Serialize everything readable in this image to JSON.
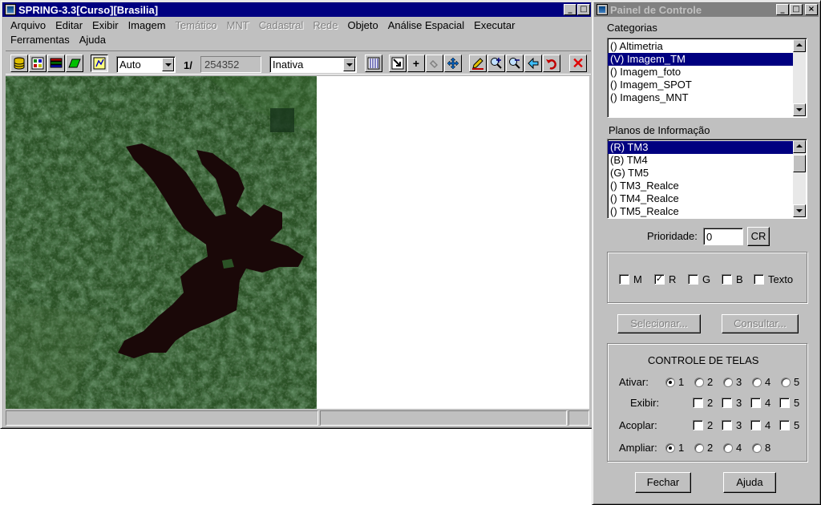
{
  "main_window": {
    "title": "SPRING-3.3[Curso][Brasilia]",
    "menu_row1": [
      {
        "label": "Arquivo",
        "enabled": true
      },
      {
        "label": "Editar",
        "enabled": true
      },
      {
        "label": "Exibir",
        "enabled": true
      },
      {
        "label": "Imagem",
        "enabled": true
      },
      {
        "label": "Temático",
        "enabled": false
      },
      {
        "label": "MNT",
        "enabled": false
      },
      {
        "label": "Cadastral",
        "enabled": false
      },
      {
        "label": "Rede",
        "enabled": false
      },
      {
        "label": "Objeto",
        "enabled": true
      },
      {
        "label": "Análise Espacial",
        "enabled": true
      },
      {
        "label": "Executar",
        "enabled": true
      }
    ],
    "menu_row2": [
      {
        "label": "Ferramentas",
        "enabled": true
      },
      {
        "label": "Ajuda",
        "enabled": true
      }
    ],
    "toolbar": {
      "zoom_mode": "Auto",
      "scale_prefix": "1/",
      "scale_value": "254352",
      "state": "Inativa"
    },
    "image": {
      "description_icons": [
        "database-icon",
        "layers-icon",
        "theme-icon",
        "polygon-icon",
        "cursor-icon"
      ],
      "water_color": "#1a0808",
      "vegetation_color": "#2f5a2a"
    }
  },
  "control_panel": {
    "title": "Painel de Controle",
    "categories_label": "Categorias",
    "categories": [
      {
        "label": "() Altimetria",
        "selected": false
      },
      {
        "label": "(V) Imagem_TM",
        "selected": true
      },
      {
        "label": "() Imagem_foto",
        "selected": false
      },
      {
        "label": "() Imagem_SPOT",
        "selected": false
      },
      {
        "label": "() Imagens_MNT",
        "selected": false
      }
    ],
    "planes_label": "Planos de Informação",
    "planes": [
      {
        "label": "(R) TM3",
        "selected": true
      },
      {
        "label": "(B) TM4",
        "selected": false
      },
      {
        "label": "(G) TM5",
        "selected": false
      },
      {
        "label": "() TM3_Realce",
        "selected": false
      },
      {
        "label": "() TM4_Realce",
        "selected": false
      },
      {
        "label": "() TM5_Realce",
        "selected": false
      }
    ],
    "priority_label": "Prioridade:",
    "priority_value": "0",
    "cr_button": "CR",
    "channels": [
      {
        "label": "M",
        "checked": false
      },
      {
        "label": "R",
        "checked": true
      },
      {
        "label": "G",
        "checked": false
      },
      {
        "label": "B",
        "checked": false
      },
      {
        "label": "Texto",
        "checked": false
      }
    ],
    "select_button": "Selecionar...",
    "query_button": "Consultar...",
    "screen_control": {
      "title": "CONTROLE DE TELAS",
      "ativar_label": "Ativar:",
      "ativar_options": [
        "1",
        "2",
        "3",
        "4",
        "5"
      ],
      "ativar_selected": "1",
      "exibir_label": "Exibir:",
      "exibir_options": [
        "2",
        "3",
        "4",
        "5"
      ],
      "acoplar_label": "Acoplar:",
      "acoplar_options": [
        "2",
        "3",
        "4",
        "5"
      ],
      "ampliar_label": "Ampliar:",
      "ampliar_options": [
        "1",
        "2",
        "4",
        "8"
      ],
      "ampliar_selected": "1"
    },
    "close_button": "Fechar",
    "help_button": "Ajuda"
  }
}
